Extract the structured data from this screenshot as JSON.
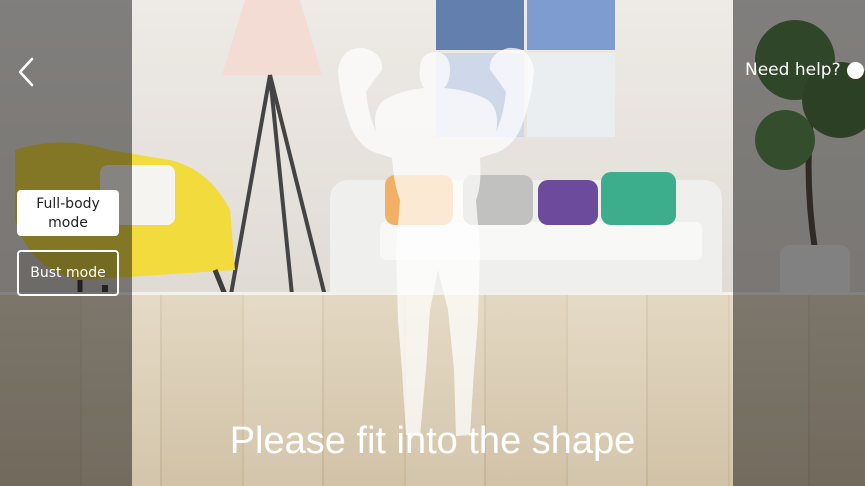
{
  "scene": {
    "description_colors": {
      "wall": "#e6e2dc",
      "floor": "#d6c4a4",
      "overlay": "#282828"
    }
  },
  "nav": {
    "back_icon": "chevron-left-icon"
  },
  "help": {
    "label": "Need help?",
    "icon": "help-dot-icon"
  },
  "modes": [
    {
      "label": "Full-body mode",
      "selected": true
    },
    {
      "label": "Bust mode",
      "selected": false
    }
  ],
  "prompt": {
    "text": "Please fit into the shape"
  },
  "colors": {
    "text": "#ffffff",
    "button_bg": "#ffffff",
    "button_text": "#222222"
  }
}
